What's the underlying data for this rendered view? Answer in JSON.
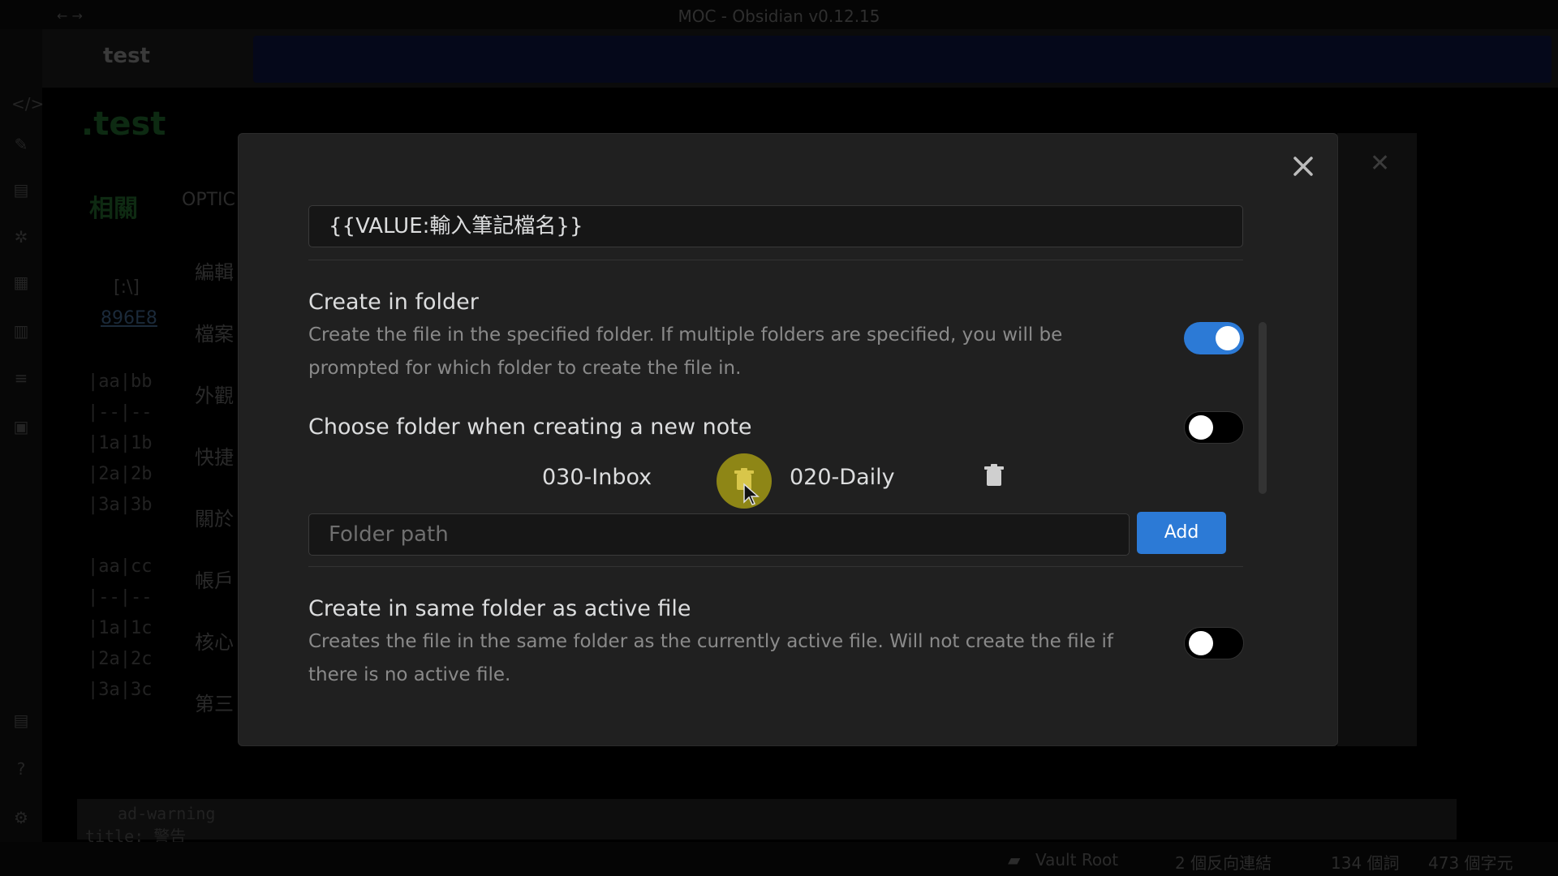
{
  "window": {
    "title": "MOC - Obsidian v0.12.15",
    "nav": "← →"
  },
  "background": {
    "tab_title": "test",
    "note_title": ".test",
    "options_label": "OPTIC",
    "heading_partial": "相關",
    "link_text": "[:\\]",
    "hash_text": "896E8",
    "menu_items": [
      "編輯",
      "檔案",
      "外觀",
      "快捷",
      "關於",
      "帳戶",
      "核心",
      "第三"
    ],
    "table_rows_1": [
      "|aa|bb",
      "|--|--",
      "|1a|1b",
      "|2a|2b",
      "|3a|3b"
    ],
    "table_rows_2": [
      "|aa|cc",
      "|--|--",
      "|1a|1c",
      "|2a|2c",
      "|3a|3c"
    ],
    "bottom_code_1": "ad-warning",
    "bottom_code_2": "title: 警告",
    "status": {
      "vault": "Vault Root",
      "backlinks": "2 個反向連結",
      "words": "134 個詞",
      "chars": "473 個字元"
    }
  },
  "modal": {
    "format_value": "{{VALUE:輸入筆記檔名}}",
    "create_in_folder": {
      "name": "Create in folder",
      "desc": "Create the file in the specified folder. If multiple folders are specified, you will be prompted for which folder to create the file in.",
      "enabled": true
    },
    "choose_folder": {
      "name": "Choose folder when creating a new note",
      "enabled": false
    },
    "folders": [
      "030-Inbox",
      "020-Daily"
    ],
    "folder_input": {
      "placeholder": "Folder path",
      "value": ""
    },
    "add_label": "Add",
    "same_folder": {
      "name": "Create in same folder as active file",
      "desc": "Creates the file in the same folder as the currently active file. Will not create the file if there is no active file.",
      "enabled": false
    }
  },
  "colors": {
    "accent": "#2c7ad6",
    "modal_bg": "#202020",
    "highlight": "#8e8616"
  }
}
